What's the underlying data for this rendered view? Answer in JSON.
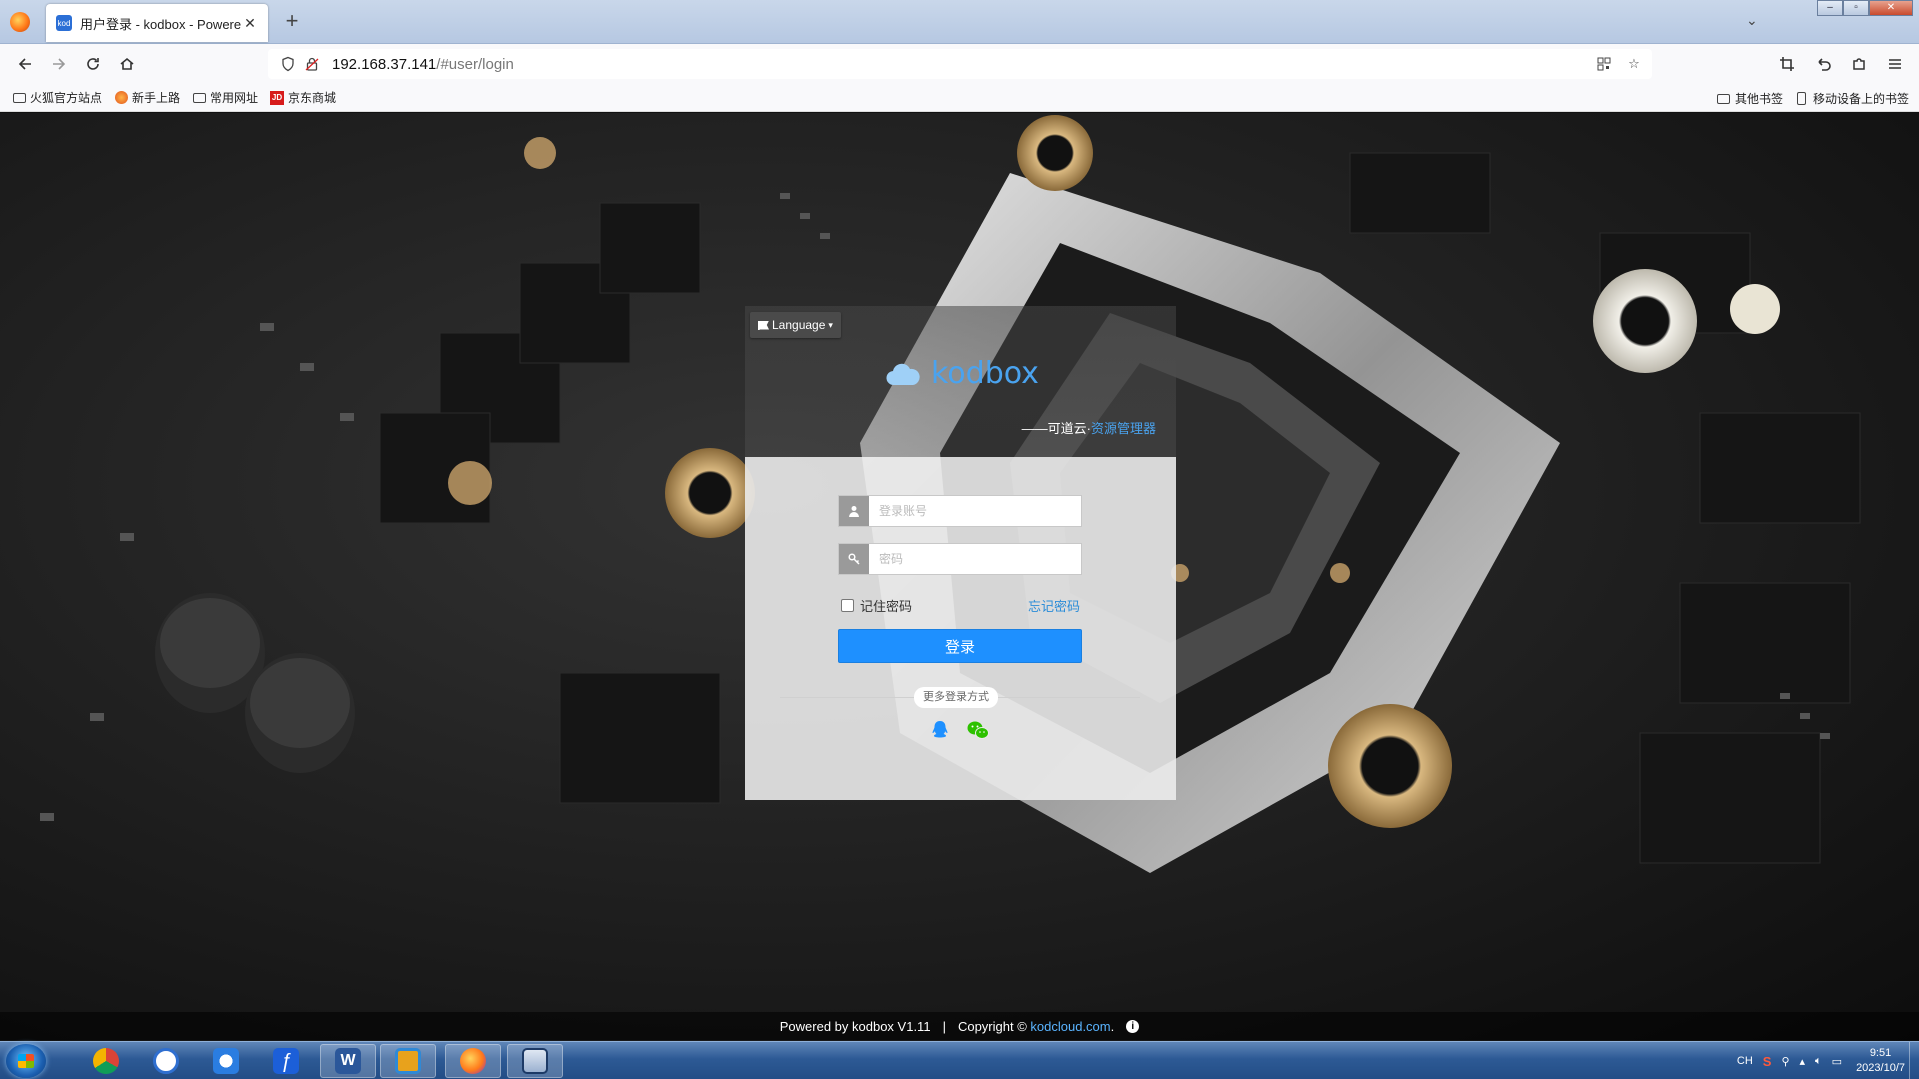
{
  "browser": {
    "tab_title": "用户登录 - kodbox - Powere",
    "favicon_text": "kod",
    "new_tab": "+",
    "url_host": "192.168.37.141",
    "url_path": "/#user/login",
    "bookmarks": [
      "火狐官方站点",
      "新手上路",
      "常用网址",
      "京东商城"
    ],
    "bookmarks_right": [
      "其他书签",
      "移动设备上的书签"
    ],
    "jd_badge": "JD"
  },
  "login": {
    "language_label": "Language",
    "brand_name": "kodbox",
    "slogan_prefix": "——可道云·",
    "slogan_highlight": "资源管理器",
    "username_placeholder": "登录账号",
    "password_placeholder": "密码",
    "remember_label": "记住密码",
    "forgot_label": "忘记密码",
    "submit_label": "登录",
    "more_login_label": "更多登录方式",
    "brand_color": "#4aa3ef",
    "button_color": "#1e90ff"
  },
  "footer": {
    "powered": "Powered by kodbox V1.11",
    "sep": "|",
    "copyright": "Copyright ©",
    "link": "kodcloud.com",
    "dot": ".",
    "info": "i"
  },
  "taskbar": {
    "tray_lang": "CH",
    "time": "9:51",
    "date": "2023/10/7",
    "apps": [
      "chrome-icon",
      "clock-app-icon",
      "baidu-netdisk-icon",
      "feishu-icon",
      "word-icon",
      "remote-app-icon",
      "firefox-icon",
      "desktop-app-icon"
    ]
  }
}
